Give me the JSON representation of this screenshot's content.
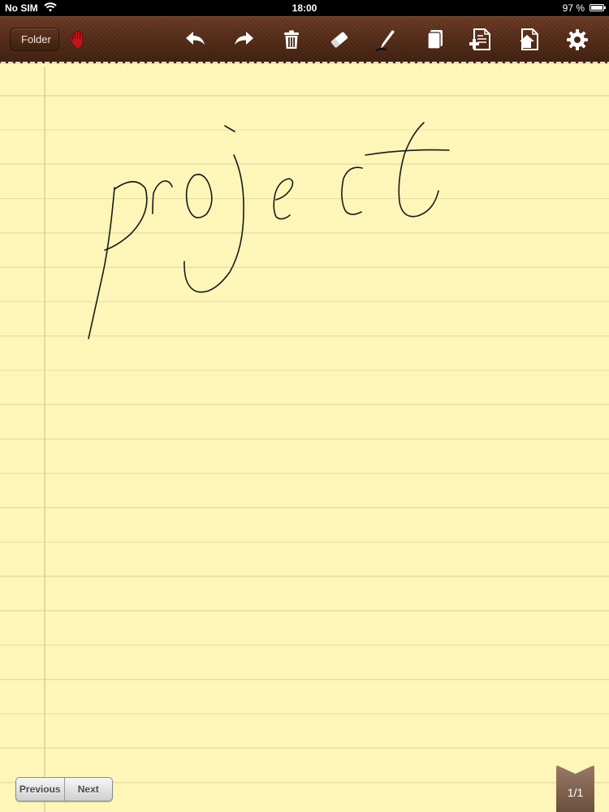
{
  "status_bar": {
    "carrier": "No SIM",
    "time": "18:00",
    "battery": "97 %",
    "battery_level": 0.97
  },
  "toolbar": {
    "folder_label": "Folder",
    "tools": [
      "hand-icon",
      "undo-icon",
      "redo-icon",
      "trash-icon",
      "eraser-icon",
      "pen-icon",
      "pages-icon",
      "add-page-icon",
      "export-icon",
      "settings-icon"
    ],
    "hand_color": "#c0141c"
  },
  "canvas": {
    "ink_color": "#1a1a1a",
    "paper_color": "#fdf6b8"
  },
  "pager": {
    "previous_label": "Previous",
    "next_label": "Next"
  },
  "page_indicator": {
    "text": "1/1"
  }
}
